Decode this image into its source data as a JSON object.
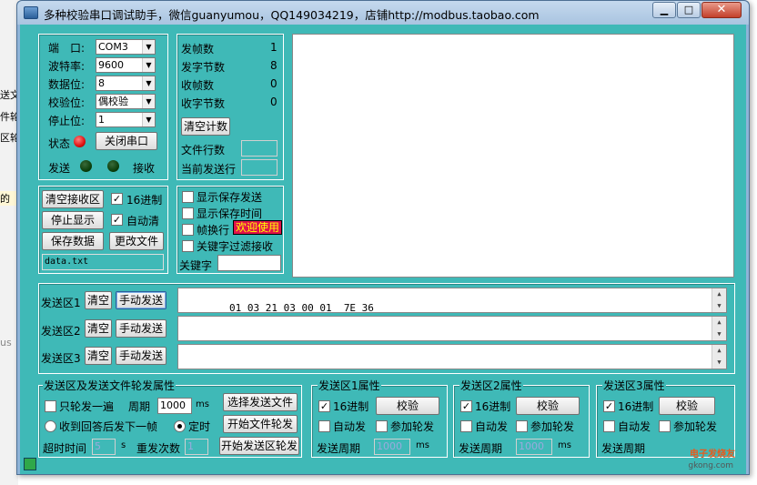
{
  "window": {
    "title": "多种校验串口调试助手，微信guanyumou，QQ149034219，店铺http://modbus.taobao.com",
    "minimize": "▁",
    "maximize": "□",
    "close": "✕"
  },
  "background_fragments": [
    "送文",
    "件轮",
    "区轮",
    "的",
    "us"
  ],
  "port_settings": {
    "port_label": "端　口:",
    "port_value": "COM3",
    "baud_label": "波特率:",
    "baud_value": "9600",
    "databits_label": "数据位:",
    "databits_value": "8",
    "parity_label": "校验位:",
    "parity_value": "偶校验",
    "stopbits_label": "停止位:",
    "stopbits_value": "1",
    "status_label": "状态",
    "close_port_button": "关闭串口",
    "send_label": "发送",
    "receive_label": "接收",
    "colors": {
      "status_led": "#e01010",
      "tx_led": "#0a3d0a",
      "rx_led": "#0a3d0a"
    }
  },
  "counters": {
    "frames_sent_label": "发帧数",
    "frames_sent": "1",
    "bytes_sent_label": "发字节数",
    "bytes_sent": "8",
    "frames_recv_label": "收帧数",
    "frames_recv": "0",
    "bytes_recv_label": "收字节数",
    "bytes_recv": "0",
    "clear_button": "清空计数",
    "file_lines_label": "文件行数",
    "current_line_label": "当前发送行"
  },
  "receive_controls": {
    "clear_recv_button": "清空接收区",
    "hex_label": "16进制",
    "hex_checked": true,
    "stop_display_button": "停止显示",
    "auto_clear_label": "自动清",
    "auto_clear_checked": true,
    "save_data_button": "保存数据",
    "change_file_button": "更改文件",
    "filename": "data.txt"
  },
  "display_options": {
    "show_saved_send": "显示保存发送",
    "show_saved_time": "显示保存时间",
    "frame_newline": "帧换行",
    "welcome_badge": "欢迎使用",
    "keyword_filter": "关键字过滤接收",
    "keyword_label": "关键字"
  },
  "send_areas": [
    {
      "label": "发送区1",
      "clear": "清空",
      "send": "手动发送",
      "content": "01 03 21 03 00 01  7E 36"
    },
    {
      "label": "发送区2",
      "clear": "清空",
      "send": "手动发送",
      "content": ""
    },
    {
      "label": "发送区3",
      "clear": "清空",
      "send": "手动发送",
      "content": ""
    }
  ],
  "rotation": {
    "group_title": "发送区及发送文件轮发属性",
    "only_once": "只轮发一遍",
    "period_label": "周期",
    "period_value": "1000",
    "period_unit": "ms",
    "select_file_button": "选择发送文件",
    "reply_next": "收到回答后发下一帧",
    "timed": "定时",
    "start_file_button": "开始文件轮发",
    "timeout_label": "超时时间",
    "timeout_value": "5",
    "timeout_unit": "s",
    "retry_label": "重发次数",
    "retry_value": "1",
    "start_area_button": "开始发送区轮发"
  },
  "area_props": [
    {
      "title": "发送区1属性",
      "hex": "16进制",
      "verify": "校验",
      "auto_send": "自动发",
      "join_rotation": "参加轮发",
      "period_label": "发送周期",
      "period_value": "1000",
      "unit": "ms"
    },
    {
      "title": "发送区2属性",
      "hex": "16进制",
      "verify": "校验",
      "auto_send": "自动发",
      "join_rotation": "参加轮发",
      "period_label": "发送周期",
      "period_value": "1000",
      "unit": "ms"
    },
    {
      "title": "发送区3属性",
      "hex": "16进制",
      "verify": "校验",
      "auto_send": "自动发",
      "join_rotation": "参加轮发",
      "period_label": "发送周期",
      "period_value": "",
      "unit": ""
    }
  ],
  "watermark": {
    "text1": "电子发烧友",
    "text2": "gkong.com"
  }
}
